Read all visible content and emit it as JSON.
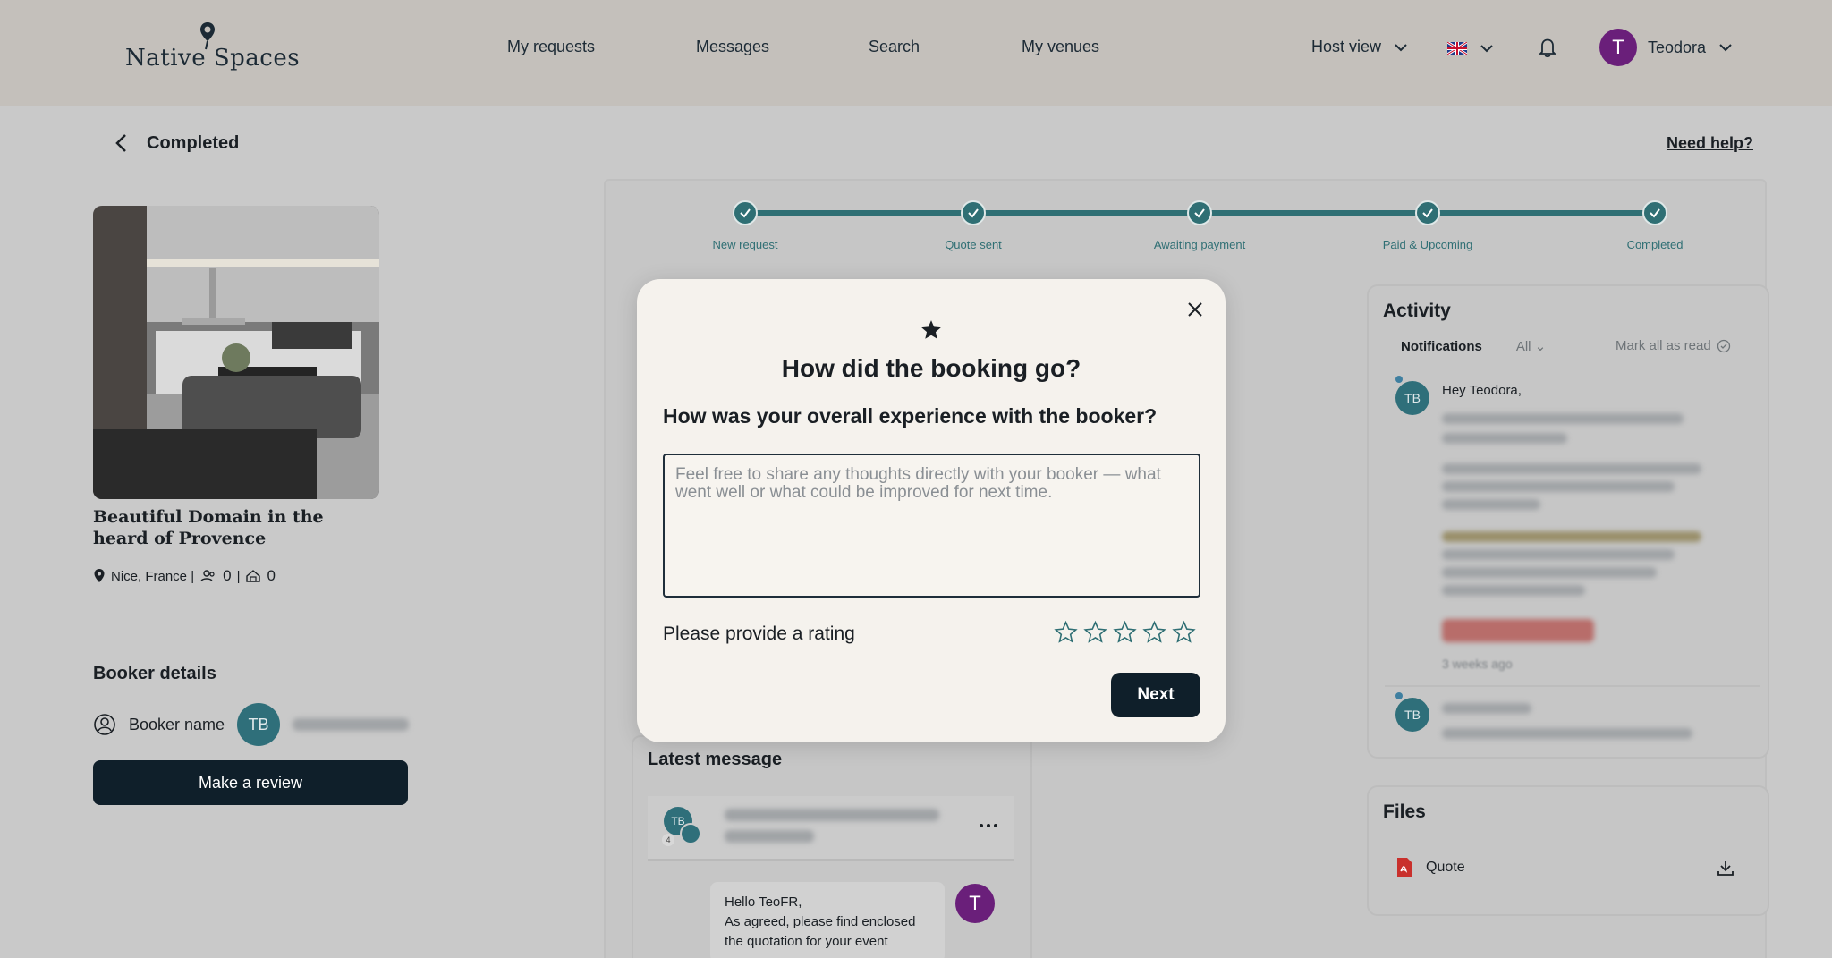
{
  "header": {
    "logo_text": "Native Spaces",
    "nav": [
      "My requests",
      "Messages",
      "Search",
      "My venues"
    ],
    "host_view": "Host view",
    "language_flag": "uk-flag-icon",
    "user_initial": "T",
    "user_name": "Teodora"
  },
  "page": {
    "back_label": "Completed",
    "need_help": "Need help?"
  },
  "venue": {
    "title": "Beautiful Domain in the heard of Provence",
    "location": "Nice, France |",
    "guests": "0",
    "rooms": "0",
    "separator": "|"
  },
  "booker": {
    "section_title": "Booker details",
    "label": "Booker name",
    "initials": "TB",
    "review_button": "Make a review"
  },
  "stepper": {
    "steps": [
      "New request",
      "Quote sent",
      "Awaiting payment",
      "Paid & Upcoming",
      "Completed"
    ]
  },
  "latest": {
    "title": "Latest message",
    "head_initials": "TB",
    "head_count": "4",
    "message": "Hello TeoFR,\nAs agreed, please find enclosed the quotation for your event",
    "sender_initial": "T"
  },
  "activity": {
    "title": "Activity",
    "tab_notifications": "Notifications",
    "tab_all": "All",
    "mark_all": "Mark all as read",
    "notif1_initials": "TB",
    "notif1_greeting": "Hey Teodora,",
    "notif1_time": "3 weeks ago",
    "notif2_initials": "TB"
  },
  "files": {
    "title": "Files",
    "file_name": "Quote"
  },
  "modal": {
    "title": "How did the booking go?",
    "question": "How was your overall experience with the booker?",
    "placeholder": "Feel free to share any thoughts directly with your booker — what went well or what could be improved for next time.",
    "rating_label": "Please provide a rating",
    "rating_value": 0,
    "rating_max": 5,
    "next_button": "Next"
  },
  "colors": {
    "accent_teal": "#2f6f74",
    "dark_button": "#0f1f2a",
    "avatar_purple": "#6a1f7a"
  }
}
